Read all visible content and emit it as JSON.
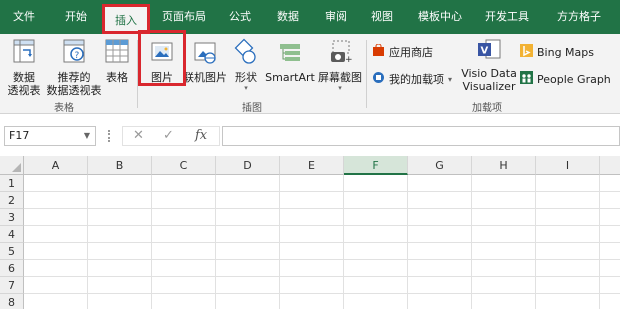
{
  "tabs": [
    {
      "label": "文件"
    },
    {
      "label": "开始"
    },
    {
      "label": "插入"
    },
    {
      "label": "页面布局"
    },
    {
      "label": "公式"
    },
    {
      "label": "数据"
    },
    {
      "label": "审阅"
    },
    {
      "label": "视图"
    },
    {
      "label": "模板中心"
    },
    {
      "label": "开发工具"
    },
    {
      "label": "方方格子"
    }
  ],
  "ribbon": {
    "tables": {
      "pivot_line1": "数据",
      "pivot_line2": "透视表",
      "recommended_line1": "推荐的",
      "recommended_line2": "数据透视表",
      "table": "表格",
      "group_label": "表格"
    },
    "illustrations": {
      "pictures": "图片",
      "online_pictures": "联机图片",
      "shapes": "形状",
      "smartart": "SmartArt",
      "screenshot": "屏幕截图",
      "group_label": "插图"
    },
    "addins": {
      "store": "应用商店",
      "my_addins": "我的加载项",
      "visio_line1": "Visio Data",
      "visio_line2": "Visualizer",
      "bing_maps": "Bing Maps",
      "people_graph": "People Graph",
      "group_label": "加载项"
    }
  },
  "formula_bar": {
    "name_box": "F17",
    "cancel_icon": "✕",
    "enter_icon": "✓",
    "fx_label": "fx",
    "formula": ""
  },
  "grid": {
    "columns": [
      "A",
      "B",
      "C",
      "D",
      "E",
      "F",
      "G",
      "H",
      "I"
    ],
    "rows": [
      "1",
      "2",
      "3",
      "4",
      "5",
      "6",
      "7",
      "8"
    ],
    "selected_column": "F"
  },
  "colors": {
    "tab_bar": "#217346",
    "highlight": "#d9272e",
    "ribbon_bg": "#f3f3f3"
  }
}
